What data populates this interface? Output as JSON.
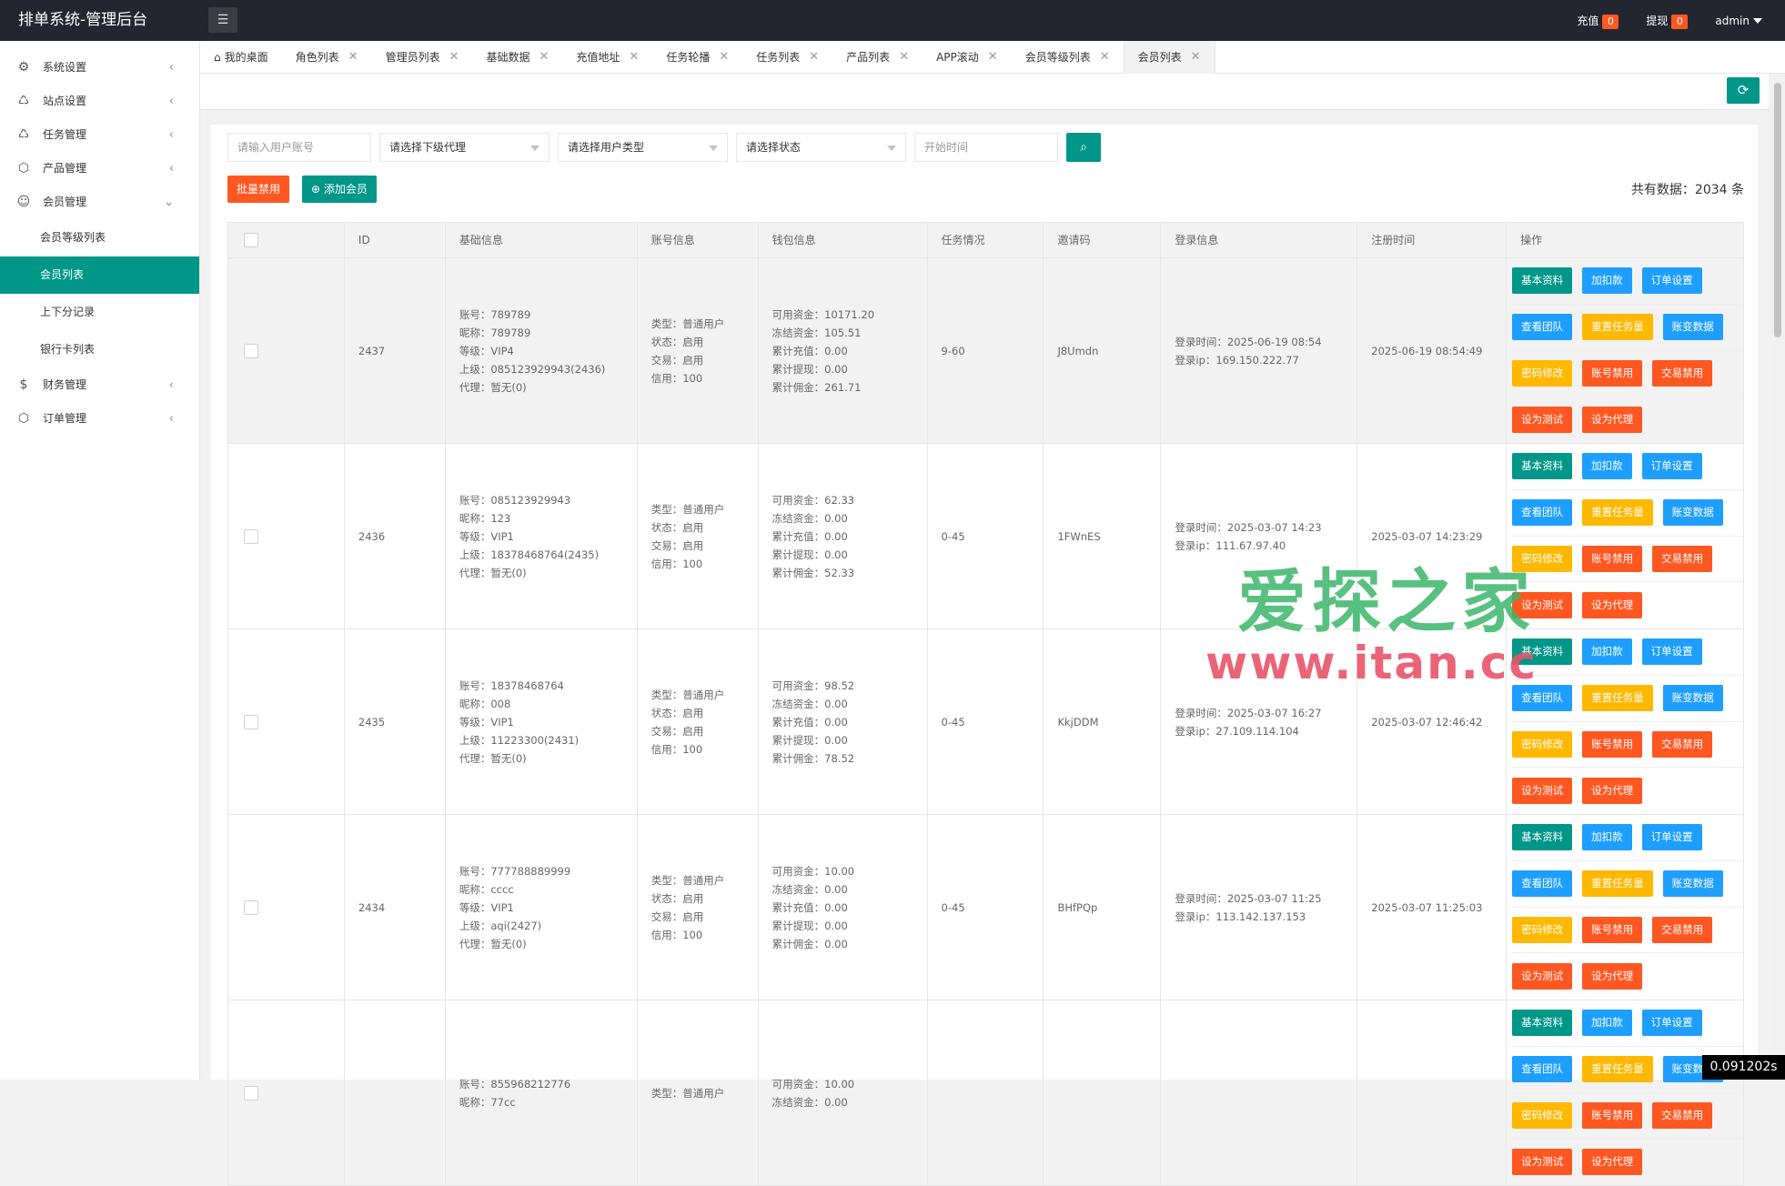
{
  "header": {
    "title": "排单系统-管理后台",
    "recharge_label": "充值",
    "recharge_count": "0",
    "withdraw_label": "提现",
    "withdraw_count": "0",
    "user": "admin"
  },
  "sidebar": {
    "items": [
      {
        "label": "系统设置",
        "icon": "gear-icon"
      },
      {
        "label": "站点设置",
        "icon": "site-icon"
      },
      {
        "label": "任务管理",
        "icon": "task-icon"
      },
      {
        "label": "产品管理",
        "icon": "box-icon"
      },
      {
        "label": "会员管理",
        "icon": "user-icon"
      },
      {
        "label": "财务管理",
        "icon": "dollar-icon"
      },
      {
        "label": "订单管理",
        "icon": "order-icon"
      }
    ],
    "sub_items": [
      "会员等级列表",
      "会员列表",
      "上下分记录",
      "银行卡列表"
    ]
  },
  "tabs": [
    "我的桌面",
    "角色列表",
    "管理员列表",
    "基础数据",
    "充值地址",
    "任务轮播",
    "任务列表",
    "产品列表",
    "APP滚动",
    "会员等级列表",
    "会员列表"
  ],
  "filters": {
    "account_placeholder": "请输入用户账号",
    "agent": "请选择下级代理",
    "user_type": "请选择用户类型",
    "status": "请选择状态",
    "time_placeholder": "开始时间"
  },
  "actions": {
    "bulk_disable": "批量禁用",
    "add_member": "添加会员",
    "total": "共有数据：2034 条"
  },
  "columns": [
    "ID",
    "基础信息",
    "账号信息",
    "钱包信息",
    "任务情况",
    "邀请码",
    "登录信息",
    "注册时间",
    "操作"
  ],
  "op_buttons": [
    [
      "基本资料",
      "加扣款",
      "订单设置"
    ],
    [
      "查看团队",
      "重置任务量",
      "账变数据"
    ],
    [
      "密码修改",
      "账号禁用",
      "交易禁用"
    ],
    [
      "设为测试",
      "设为代理"
    ]
  ],
  "rows": [
    {
      "id": "2437",
      "basic": [
        "账号：789789",
        "昵称：789789",
        "等级：VIP4",
        "上级：085123929943(2436)",
        "代理：暂无(0)"
      ],
      "account": [
        "类型：普通用户",
        "状态：启用",
        "交易：启用",
        "信用：100"
      ],
      "wallet": [
        "可用资金：10171.20",
        "冻结资金：105.51",
        "累计充值：0.00",
        "累计提现：0.00",
        "累计佣金：261.71"
      ],
      "task": "9-60",
      "invite": "J8Umdn",
      "login": [
        "登录时间：2025-06-19 08:54",
        "登录ip：169.150.222.77"
      ],
      "reg": "2025-06-19 08:54:49"
    },
    {
      "id": "2436",
      "basic": [
        "账号：085123929943",
        "昵称：123",
        "等级：VIP1",
        "上级：18378468764(2435)",
        "代理：暂无(0)"
      ],
      "account": [
        "类型：普通用户",
        "状态：启用",
        "交易：启用",
        "信用：100"
      ],
      "wallet": [
        "可用资金：62.33",
        "冻结资金：0.00",
        "累计充值：0.00",
        "累计提现：0.00",
        "累计佣金：52.33"
      ],
      "task": "0-45",
      "invite": "1FWnES",
      "login": [
        "登录时间：2025-03-07 14:23",
        "登录ip：111.67.97.40"
      ],
      "reg": "2025-03-07 14:23:29"
    },
    {
      "id": "2435",
      "basic": [
        "账号：18378468764",
        "昵称：008",
        "等级：VIP1",
        "上级：11223300(2431)",
        "代理：暂无(0)"
      ],
      "account": [
        "类型：普通用户",
        "状态：启用",
        "交易：启用",
        "信用：100"
      ],
      "wallet": [
        "可用资金：98.52",
        "冻结资金：0.00",
        "累计充值：0.00",
        "累计提现：0.00",
        "累计佣金：78.52"
      ],
      "task": "0-45",
      "invite": "KkjDDM",
      "login": [
        "登录时间：2025-03-07 16:27",
        "登录ip：27.109.114.104"
      ],
      "reg": "2025-03-07 12:46:42"
    },
    {
      "id": "2434",
      "basic": [
        "账号：777788889999",
        "昵称：cccc",
        "等级：VIP1",
        "上级：aqi(2427)",
        "代理：暂无(0)"
      ],
      "account": [
        "类型：普通用户",
        "状态：启用",
        "交易：启用",
        "信用：100"
      ],
      "wallet": [
        "可用资金：10.00",
        "冻结资金：0.00",
        "累计充值：0.00",
        "累计提现：0.00",
        "累计佣金：0.00"
      ],
      "task": "0-45",
      "invite": "BHfPQp",
      "login": [
        "登录时间：2025-03-07 11:25",
        "登录ip：113.142.137.153"
      ],
      "reg": "2025-03-07 11:25:03"
    },
    {
      "id": "",
      "basic": [
        "账号：855968212776",
        "昵称：77cc",
        "",
        "",
        ""
      ],
      "account": [
        "类型：普通用户",
        "",
        "",
        "",
        ""
      ],
      "wallet": [
        "可用资金：10.00",
        "冻结资金：0.00",
        "",
        "",
        ""
      ],
      "task": "",
      "invite": "",
      "login": [
        "",
        ""
      ],
      "reg": ""
    }
  ],
  "watermark": {
    "cn": "爱探之家",
    "url": "www.itan.cc"
  },
  "timer": "0.091202s"
}
